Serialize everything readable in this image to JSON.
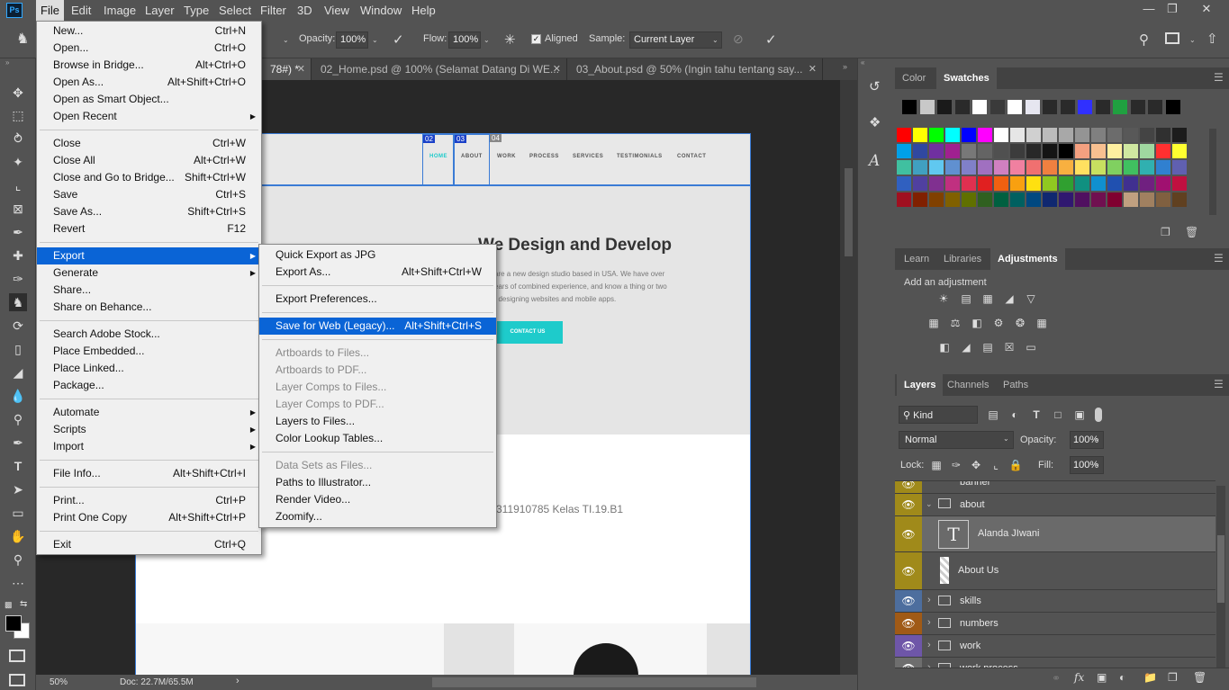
{
  "menubar": {
    "app_logo": "Ps",
    "items": [
      "File",
      "Edit",
      "Image",
      "Layer",
      "Type",
      "Select",
      "Filter",
      "3D",
      "View",
      "Window",
      "Help"
    ]
  },
  "options": {
    "opacity_label": "Opacity:",
    "opacity_value": "100%",
    "flow_label": "Flow:",
    "flow_value": "100%",
    "aligned_label": "Aligned",
    "sample_label": "Sample:",
    "sample_value": "Current Layer"
  },
  "doc_tabs": [
    {
      "title": "78#) *"
    },
    {
      "title": "02_Home.psd @ 100% (Selamat Datang Di WE..."
    },
    {
      "title": "03_About.psd @ 50% (Ingin tahu tentang say..."
    }
  ],
  "document": {
    "nav_tags": [
      "02",
      "03",
      "04"
    ],
    "nav": [
      "HOME",
      "ABOUT",
      "WORK",
      "PROCESS",
      "SERVICES",
      "TESTIMONIALS",
      "CONTACT"
    ],
    "hero_title": "We Design and Develop",
    "hero_lines": [
      "are a new design studio based in USA. We have over",
      "ears of combined experience, and know a thing or two",
      "t designing websites and mobile apps."
    ],
    "contact_button": "CONTACT US",
    "student_text": "311910785 Kelas TI.19.B1"
  },
  "status": {
    "zoom": "50%",
    "doc": "Doc: 22.7M/65.5M"
  },
  "file_menu": {
    "groups": [
      [
        {
          "label": "New...",
          "shortcut": "Ctrl+N"
        },
        {
          "label": "Open...",
          "shortcut": "Ctrl+O"
        },
        {
          "label": "Browse in Bridge...",
          "shortcut": "Alt+Ctrl+O"
        },
        {
          "label": "Open As...",
          "shortcut": "Alt+Shift+Ctrl+O"
        },
        {
          "label": "Open as Smart Object...",
          "shortcut": ""
        },
        {
          "label": "Open Recent",
          "shortcut": "",
          "sub": true
        }
      ],
      [
        {
          "label": "Close",
          "shortcut": "Ctrl+W"
        },
        {
          "label": "Close All",
          "shortcut": "Alt+Ctrl+W"
        },
        {
          "label": "Close and Go to Bridge...",
          "shortcut": "Shift+Ctrl+W"
        },
        {
          "label": "Save",
          "shortcut": "Ctrl+S"
        },
        {
          "label": "Save As...",
          "shortcut": "Shift+Ctrl+S"
        },
        {
          "label": "Revert",
          "shortcut": "F12"
        }
      ],
      [
        {
          "label": "Export",
          "shortcut": "",
          "sub": true,
          "hl": true
        },
        {
          "label": "Generate",
          "shortcut": "",
          "sub": true
        },
        {
          "label": "Share...",
          "shortcut": ""
        },
        {
          "label": "Share on Behance...",
          "shortcut": ""
        }
      ],
      [
        {
          "label": "Search Adobe Stock...",
          "shortcut": ""
        },
        {
          "label": "Place Embedded...",
          "shortcut": ""
        },
        {
          "label": "Place Linked...",
          "shortcut": ""
        },
        {
          "label": "Package...",
          "shortcut": ""
        }
      ],
      [
        {
          "label": "Automate",
          "shortcut": "",
          "sub": true
        },
        {
          "label": "Scripts",
          "shortcut": "",
          "sub": true
        },
        {
          "label": "Import",
          "shortcut": "",
          "sub": true
        }
      ],
      [
        {
          "label": "File Info...",
          "shortcut": "Alt+Shift+Ctrl+I"
        }
      ],
      [
        {
          "label": "Print...",
          "shortcut": "Ctrl+P"
        },
        {
          "label": "Print One Copy",
          "shortcut": "Alt+Shift+Ctrl+P"
        }
      ],
      [
        {
          "label": "Exit",
          "shortcut": "Ctrl+Q"
        }
      ]
    ]
  },
  "export_menu": {
    "groups": [
      [
        {
          "label": "Quick Export as JPG",
          "shortcut": ""
        },
        {
          "label": "Export As...",
          "shortcut": "Alt+Shift+Ctrl+W"
        }
      ],
      [
        {
          "label": "Export Preferences...",
          "shortcut": ""
        }
      ],
      [
        {
          "label": "Save for Web (Legacy)...",
          "shortcut": "Alt+Shift+Ctrl+S",
          "hl": true
        }
      ],
      [
        {
          "label": "Artboards to Files...",
          "shortcut": "",
          "dis": true
        },
        {
          "label": "Artboards to PDF...",
          "shortcut": "",
          "dis": true
        },
        {
          "label": "Layer Comps to Files...",
          "shortcut": "",
          "dis": true
        },
        {
          "label": "Layer Comps to PDF...",
          "shortcut": "",
          "dis": true
        },
        {
          "label": "Layers to Files...",
          "shortcut": ""
        },
        {
          "label": "Color Lookup Tables...",
          "shortcut": ""
        }
      ],
      [
        {
          "label": "Data Sets as Files...",
          "shortcut": "",
          "dis": true
        },
        {
          "label": "Paths to Illustrator...",
          "shortcut": ""
        },
        {
          "label": "Render Video...",
          "shortcut": ""
        },
        {
          "label": "Zoomify...",
          "shortcut": ""
        }
      ]
    ]
  },
  "color_panel": {
    "tabs": [
      "Color",
      "Swatches"
    ]
  },
  "swatch_rows": [
    [
      "#000000",
      "#c8c8c8",
      "#1a1a1a",
      "#2a2a2a",
      "#ffffff",
      "#3a3a3a",
      "#ffffff",
      "#e6e6f0",
      "#2a2a2a",
      "#2a2a2a",
      "#3030ff",
      "#2a2a2a",
      "#20a040",
      "#2a2a2a",
      "#2a2a2a",
      "#000000"
    ],
    [
      "#ff0000",
      "#ffff00",
      "#00ff00",
      "#00ffff",
      "#0000ff",
      "#ff00ff",
      "#ffffff",
      "#e6e6e6",
      "#d0d0d0",
      "#bcbcbc",
      "#a8a8a8",
      "#949494",
      "#808080",
      "#6c6c6c",
      "#585858",
      "#444444",
      "#303030",
      "#1c1c1c"
    ],
    [
      "#00a0e8",
      "#3048a0",
      "#7030a0",
      "#a02090",
      "#787878",
      "#646464",
      "#505050",
      "#3c3c3c",
      "#282828",
      "#141414",
      "#000000",
      "#f4a080",
      "#f8c090",
      "#fff0a0",
      "#d0e8a0",
      "#a0d8a0",
      "#ff3030",
      "#ffff30"
    ],
    [
      "#40c0a0",
      "#40a0c0",
      "#60c8f0",
      "#6090d0",
      "#8080c8",
      "#a070c0",
      "#d080c0",
      "#f080a0",
      "#f07070",
      "#f08040",
      "#f8b040",
      "#ffe060",
      "#c8e060",
      "#80d060",
      "#40c060",
      "#30b0b0",
      "#3080d0",
      "#6060b0"
    ],
    [
      "#3060c0",
      "#5040a0",
      "#803090",
      "#c03080",
      "#e03050",
      "#e02020",
      "#f06010",
      "#f8a010",
      "#ffe010",
      "#90c820",
      "#30a030",
      "#109080",
      "#1090d0",
      "#2050b0",
      "#403090",
      "#702080",
      "#a01070",
      "#c01040"
    ],
    [
      "#a01020",
      "#802000",
      "#804000",
      "#806000",
      "#607000",
      "#306020",
      "#006040",
      "#006060",
      "#004880",
      "#102870",
      "#301870",
      "#501060",
      "#701050",
      "#800030",
      "#c0a080",
      "#a08060",
      "#806040",
      "#604020"
    ]
  ],
  "adjustments": {
    "tabs": [
      "Learn",
      "Libraries",
      "Adjustments"
    ],
    "heading": "Add an adjustment"
  },
  "layers": {
    "tabs": [
      "Layers",
      "Channels",
      "Paths"
    ],
    "kind_label": "Kind",
    "blend": "Normal",
    "opacity_label": "Opacity:",
    "opacity_value": "100%",
    "lock_label": "Lock:",
    "fill_label": "Fill:",
    "fill_value": "100%",
    "rows": [
      {
        "name": "banner",
        "type": "group",
        "color": "#a08a1a"
      },
      {
        "name": "about",
        "type": "group",
        "color": "#a08a1a"
      },
      {
        "name": "Alanda JIwani",
        "type": "text",
        "color": "#a08a1a"
      },
      {
        "name": "About Us",
        "type": "shape",
        "color": "#a08a1a"
      },
      {
        "name": "skills",
        "type": "group",
        "color": "#4d6e9e"
      },
      {
        "name": "numbers",
        "type": "group",
        "color": "#a05a16"
      },
      {
        "name": "work",
        "type": "group",
        "color": "#6e56a8"
      },
      {
        "name": "work process",
        "type": "group",
        "color": "#6e6e6e"
      }
    ]
  },
  "icons": {
    "tools": [
      "move-icon",
      "marquee-icon",
      "lasso-icon",
      "magic-wand-icon",
      "crop-icon",
      "frame-icon",
      "eyedropper-icon",
      "healing-brush-icon",
      "brush-icon",
      "clone-stamp-icon",
      "history-brush-icon",
      "eraser-icon",
      "gradient-icon",
      "blur-icon",
      "dodge-icon",
      "pen-icon",
      "type-icon",
      "path-select-icon",
      "rectangle-icon",
      "hand-icon",
      "zoom-icon",
      "more-tools-icon"
    ]
  }
}
